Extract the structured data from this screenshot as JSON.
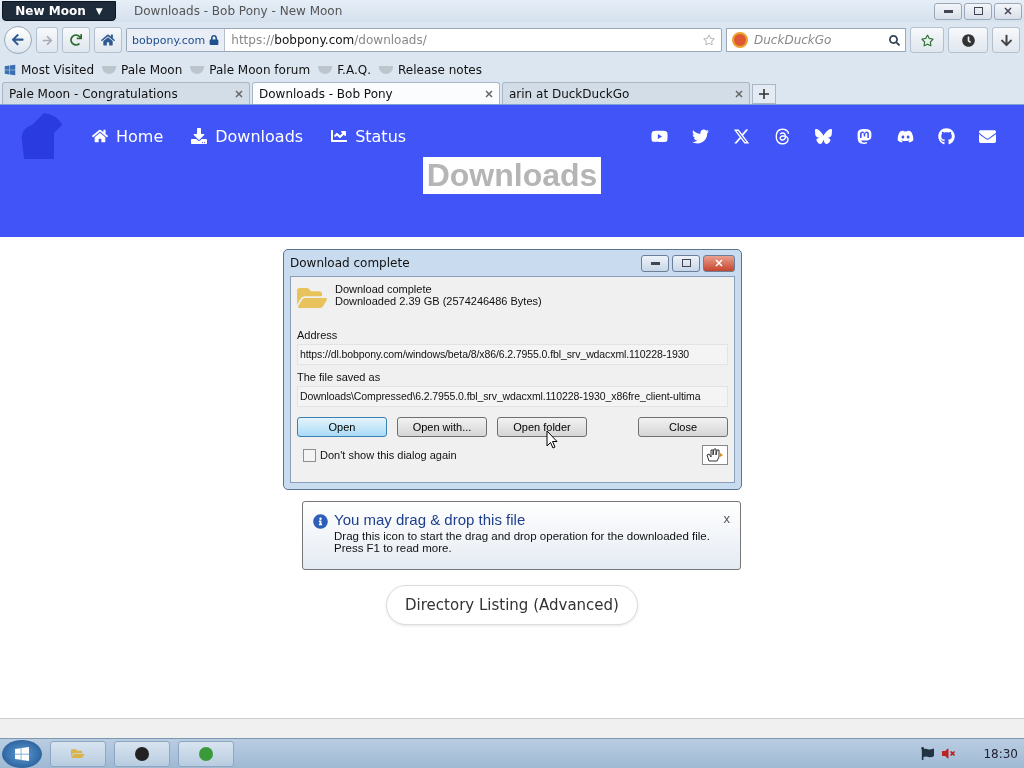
{
  "window": {
    "app_menu": "New Moon",
    "app_menu_caret": "▼",
    "title": "Downloads - Bob Pony - New Moon"
  },
  "toolbar": {
    "site_identity": "bobpony.com",
    "url": {
      "scheme": "https://",
      "host": "bobpony.com",
      "path": "/downloads/"
    },
    "search": {
      "placeholder": "DuckDuckGo"
    }
  },
  "bookmarks": [
    "Most Visited",
    "Pale Moon",
    "Pale Moon forum",
    "F.A.Q.",
    "Release notes"
  ],
  "tabs": [
    {
      "label": "Pale Moon - Congratulations",
      "selected": false
    },
    {
      "label": "Downloads - Bob Pony",
      "selected": true
    },
    {
      "label": "arin at DuckDuckGo",
      "selected": false
    }
  ],
  "page": {
    "nav": [
      "Home",
      "Downloads",
      "Status"
    ],
    "heading": "Downloads",
    "directory_button": "Directory Listing (Advanced)"
  },
  "dialog": {
    "title": "Download complete",
    "status": "Download complete",
    "size": "Downloaded 2.39  GB (2574246486 Bytes)",
    "address_label": "Address",
    "address": "https://dl.bobpony.com/windows/beta/8/x86/6.2.7955.0.fbl_srv_wdacxml.110228-1930",
    "saved_label": "The file saved as",
    "saved": "Downloads\\Compressed\\6.2.7955.0.fbl_srv_wdacxml.110228-1930_x86fre_client-ultima",
    "buttons": [
      {
        "label": "Open",
        "default": true
      },
      {
        "label": "Open with...",
        "default": false
      },
      {
        "label": "Open folder",
        "default": false
      },
      {
        "label": "Close",
        "default": false
      }
    ],
    "dont_show": {
      "label": "Don't show this dialog again",
      "checked": false
    }
  },
  "balloon": {
    "title": "You may drag & drop this file",
    "text": "Drag this icon to start the drag and drop operation for the downloaded file.",
    "text_2": "Press F1 to read more.",
    "close": "x"
  },
  "taskbar": {
    "clock": "18:30"
  }
}
